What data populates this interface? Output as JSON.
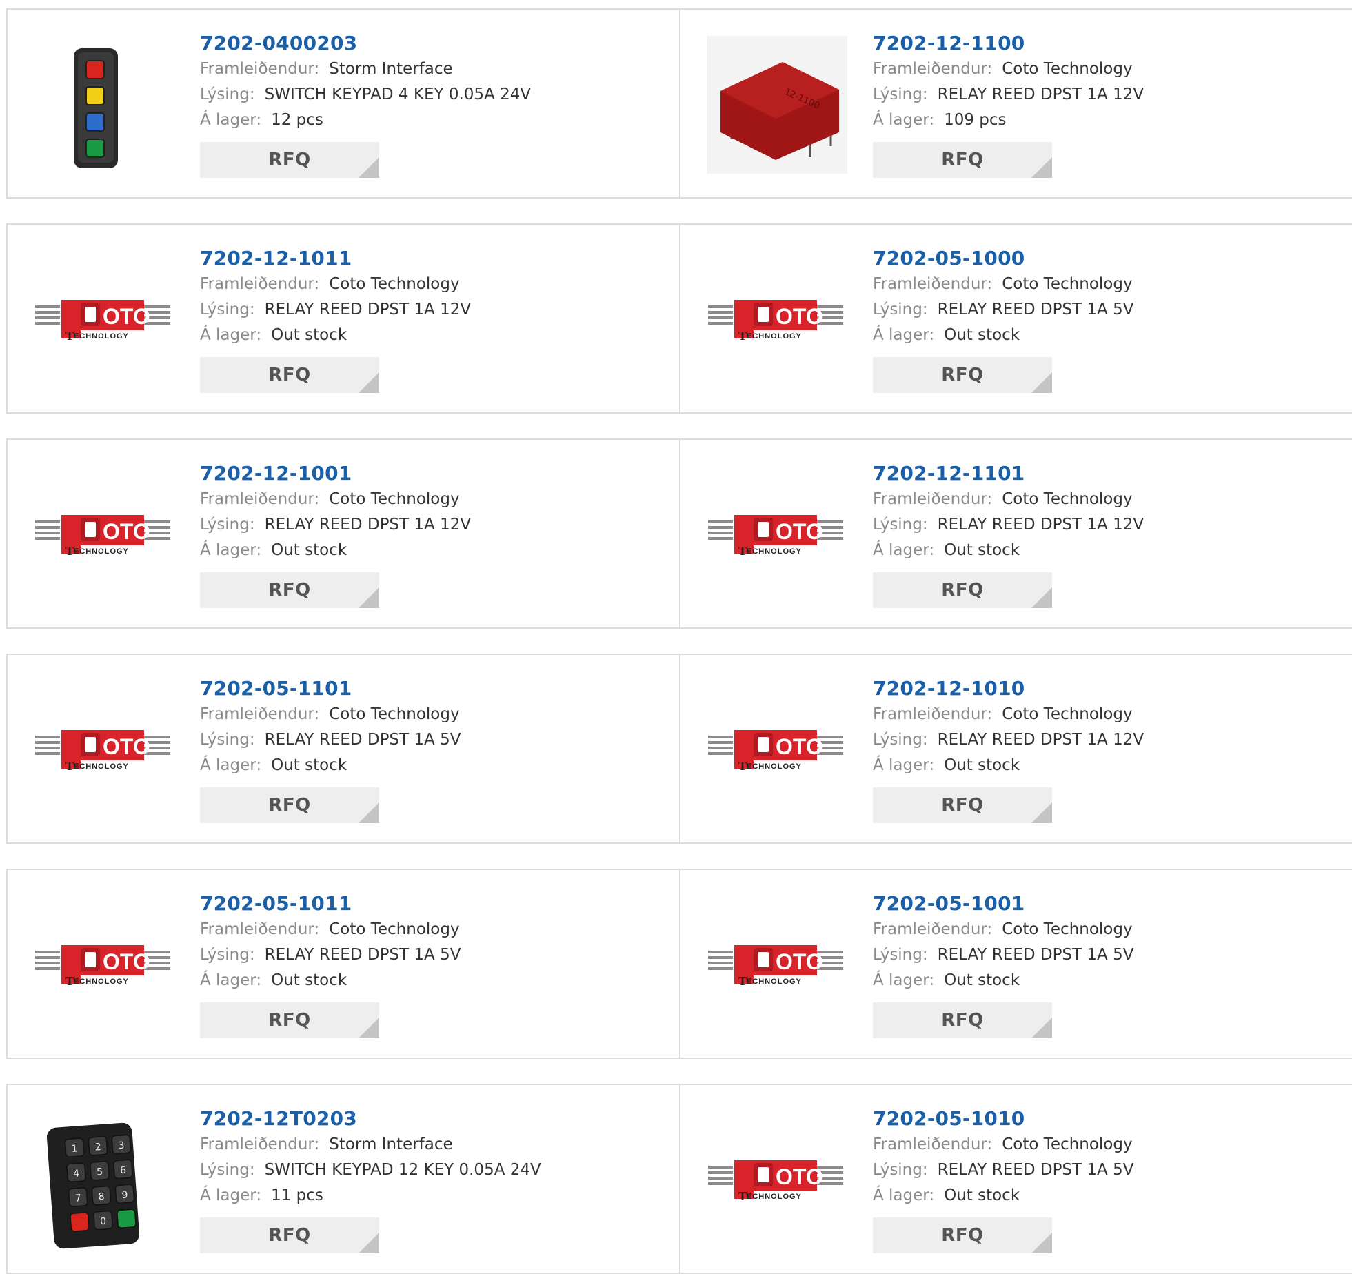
{
  "labels": {
    "manufacturer": "Framleiðendur:",
    "description": "Lýsing:",
    "stock": "Á lager:",
    "rfq": "RFQ"
  },
  "logo_text": {
    "main": "OTO",
    "sub": "ECHNOLOGY",
    "initial": "T"
  },
  "colors": {
    "link": "#1a5fa8",
    "coto_red": "#d8232a",
    "rfq_bg": "#eeeeee"
  },
  "products": [
    {
      "part": "7202-0400203",
      "manufacturer": "Storm Interface",
      "description": "SWITCH KEYPAD 4 KEY 0.05A 24V",
      "stock": "12 pcs",
      "image": "keypad-4-icon"
    },
    {
      "part": "7202-12-1100",
      "manufacturer": "Coto Technology",
      "description": "RELAY REED DPST 1A 12V",
      "stock": "109 pcs",
      "image": "relay-icon"
    },
    {
      "part": "7202-12-1011",
      "manufacturer": "Coto Technology",
      "description": "RELAY REED DPST 1A 12V",
      "stock": "Out stock",
      "image": "coto-logo"
    },
    {
      "part": "7202-05-1000",
      "manufacturer": "Coto Technology",
      "description": "RELAY REED DPST 1A 5V",
      "stock": "Out stock",
      "image": "coto-logo"
    },
    {
      "part": "7202-12-1001",
      "manufacturer": "Coto Technology",
      "description": "RELAY REED DPST 1A 12V",
      "stock": "Out stock",
      "image": "coto-logo"
    },
    {
      "part": "7202-12-1101",
      "manufacturer": "Coto Technology",
      "description": "RELAY REED DPST 1A 12V",
      "stock": "Out stock",
      "image": "coto-logo"
    },
    {
      "part": "7202-05-1101",
      "manufacturer": "Coto Technology",
      "description": "RELAY REED DPST 1A 5V",
      "stock": "Out stock",
      "image": "coto-logo"
    },
    {
      "part": "7202-12-1010",
      "manufacturer": "Coto Technology",
      "description": "RELAY REED DPST 1A 12V",
      "stock": "Out stock",
      "image": "coto-logo"
    },
    {
      "part": "7202-05-1011",
      "manufacturer": "Coto Technology",
      "description": "RELAY REED DPST 1A 5V",
      "stock": "Out stock",
      "image": "coto-logo"
    },
    {
      "part": "7202-05-1001",
      "manufacturer": "Coto Technology",
      "description": "RELAY REED DPST 1A 5V",
      "stock": "Out stock",
      "image": "coto-logo"
    },
    {
      "part": "7202-12T0203",
      "manufacturer": "Storm Interface",
      "description": "SWITCH KEYPAD 12 KEY 0.05A 24V",
      "stock": "11 pcs",
      "image": "keypad-12-icon"
    },
    {
      "part": "7202-05-1010",
      "manufacturer": "Coto Technology",
      "description": "RELAY REED DPST 1A 5V",
      "stock": "Out stock",
      "image": "coto-logo"
    }
  ],
  "keypad12_keys": [
    "1",
    "2",
    "3",
    "4",
    "5",
    "6",
    "7",
    "8",
    "9",
    "",
    "0",
    ""
  ],
  "relay_marking": "12-1100"
}
